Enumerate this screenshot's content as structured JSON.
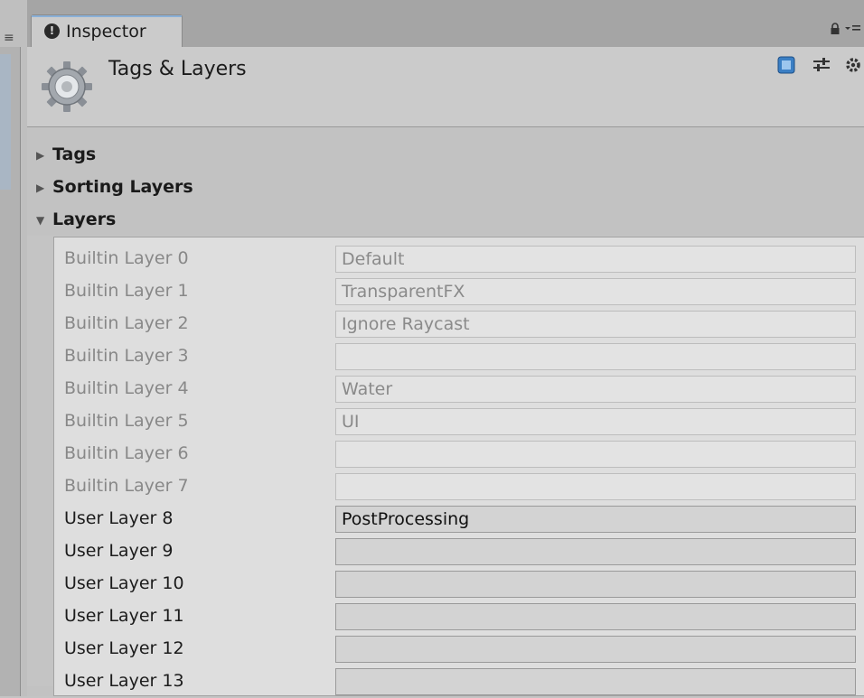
{
  "tab": {
    "label": "Inspector",
    "info_glyph": "!"
  },
  "header": {
    "title": "Tags & Layers"
  },
  "sections": [
    {
      "label": "Tags",
      "expanded": false
    },
    {
      "label": "Sorting Layers",
      "expanded": false
    },
    {
      "label": "Layers",
      "expanded": true
    }
  ],
  "layers": [
    {
      "label": "Builtin Layer 0",
      "value": "Default",
      "builtin": true
    },
    {
      "label": "Builtin Layer 1",
      "value": "TransparentFX",
      "builtin": true
    },
    {
      "label": "Builtin Layer 2",
      "value": "Ignore Raycast",
      "builtin": true
    },
    {
      "label": "Builtin Layer 3",
      "value": "",
      "builtin": true
    },
    {
      "label": "Builtin Layer 4",
      "value": "Water",
      "builtin": true
    },
    {
      "label": "Builtin Layer 5",
      "value": "UI",
      "builtin": true
    },
    {
      "label": "Builtin Layer 6",
      "value": "",
      "builtin": true
    },
    {
      "label": "Builtin Layer 7",
      "value": "",
      "builtin": true
    },
    {
      "label": "User Layer 8",
      "value": "PostProcessing",
      "builtin": false
    },
    {
      "label": "User Layer 9",
      "value": "",
      "builtin": false
    },
    {
      "label": "User Layer 10",
      "value": "",
      "builtin": false
    },
    {
      "label": "User Layer 11",
      "value": "",
      "builtin": false
    },
    {
      "label": "User Layer 12",
      "value": "",
      "builtin": false
    },
    {
      "label": "User Layer 13",
      "value": "",
      "builtin": false
    }
  ],
  "icons": {
    "header": [
      "help-book-icon",
      "preset-sliders-icon",
      "gear-menu-icon"
    ],
    "tab": [
      "lock-icon",
      "tab-menu-icon"
    ]
  },
  "colors": {
    "accent_tab_line": "#8ab0d8",
    "help_icon": "#3b7fc4"
  }
}
